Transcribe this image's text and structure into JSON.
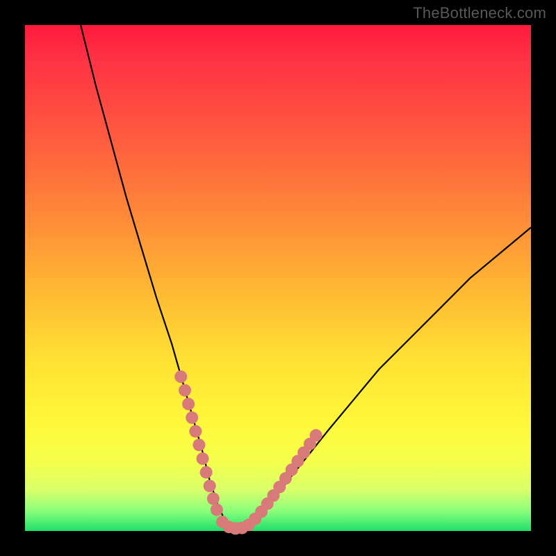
{
  "watermark": "TheBottleneck.com",
  "colors": {
    "bead": "#d87a7a",
    "curve": "#000000",
    "frame": "#000000"
  },
  "chart_data": {
    "type": "line",
    "title": "",
    "xlabel": "",
    "ylabel": "",
    "xlim": [
      0,
      100
    ],
    "ylim": [
      0,
      100
    ],
    "grid": false,
    "legend": false,
    "note": "Axes are unlabeled in the source image; values are normalized 0–100 estimates read from pixel positions.",
    "series": [
      {
        "name": "curve",
        "x": [
          11,
          14,
          17,
          20,
          23,
          26,
          29,
          31,
          33,
          35,
          36.5,
          38,
          39.5,
          41,
          43,
          46,
          49,
          52,
          56,
          60,
          65,
          70,
          76,
          82,
          88,
          94,
          100
        ],
        "y": [
          100,
          88,
          77,
          66,
          56,
          46,
          37,
          30,
          23,
          16,
          10,
          5.5,
          2,
          0.5,
          0.5,
          2.5,
          6,
          10,
          15,
          20,
          26,
          32,
          38,
          44,
          50,
          55,
          60
        ]
      }
    ],
    "beads": {
      "left_cluster": [
        {
          "x": 30.8,
          "y": 30.5
        },
        {
          "x": 31.6,
          "y": 27.8
        },
        {
          "x": 32.3,
          "y": 25.1
        },
        {
          "x": 33.0,
          "y": 22.4
        },
        {
          "x": 33.7,
          "y": 19.7
        },
        {
          "x": 34.4,
          "y": 17.0
        },
        {
          "x": 35.1,
          "y": 14.3
        },
        {
          "x": 35.8,
          "y": 11.6
        },
        {
          "x": 36.5,
          "y": 8.9
        },
        {
          "x": 37.2,
          "y": 6.4
        },
        {
          "x": 37.9,
          "y": 4.2
        }
      ],
      "bottom_cluster": [
        {
          "x": 39.0,
          "y": 1.8
        },
        {
          "x": 40.3,
          "y": 0.8
        },
        {
          "x": 41.6,
          "y": 0.5
        },
        {
          "x": 42.9,
          "y": 0.6
        },
        {
          "x": 44.2,
          "y": 1.2
        }
      ],
      "right_cluster": [
        {
          "x": 45.5,
          "y": 2.4
        },
        {
          "x": 46.7,
          "y": 3.8
        },
        {
          "x": 47.9,
          "y": 5.4
        },
        {
          "x": 49.1,
          "y": 7.0
        },
        {
          "x": 50.3,
          "y": 8.7
        },
        {
          "x": 51.5,
          "y": 10.4
        },
        {
          "x": 52.7,
          "y": 12.1
        },
        {
          "x": 53.9,
          "y": 13.8
        },
        {
          "x": 55.1,
          "y": 15.5
        },
        {
          "x": 56.3,
          "y": 17.2
        },
        {
          "x": 57.5,
          "y": 18.9
        }
      ]
    }
  }
}
